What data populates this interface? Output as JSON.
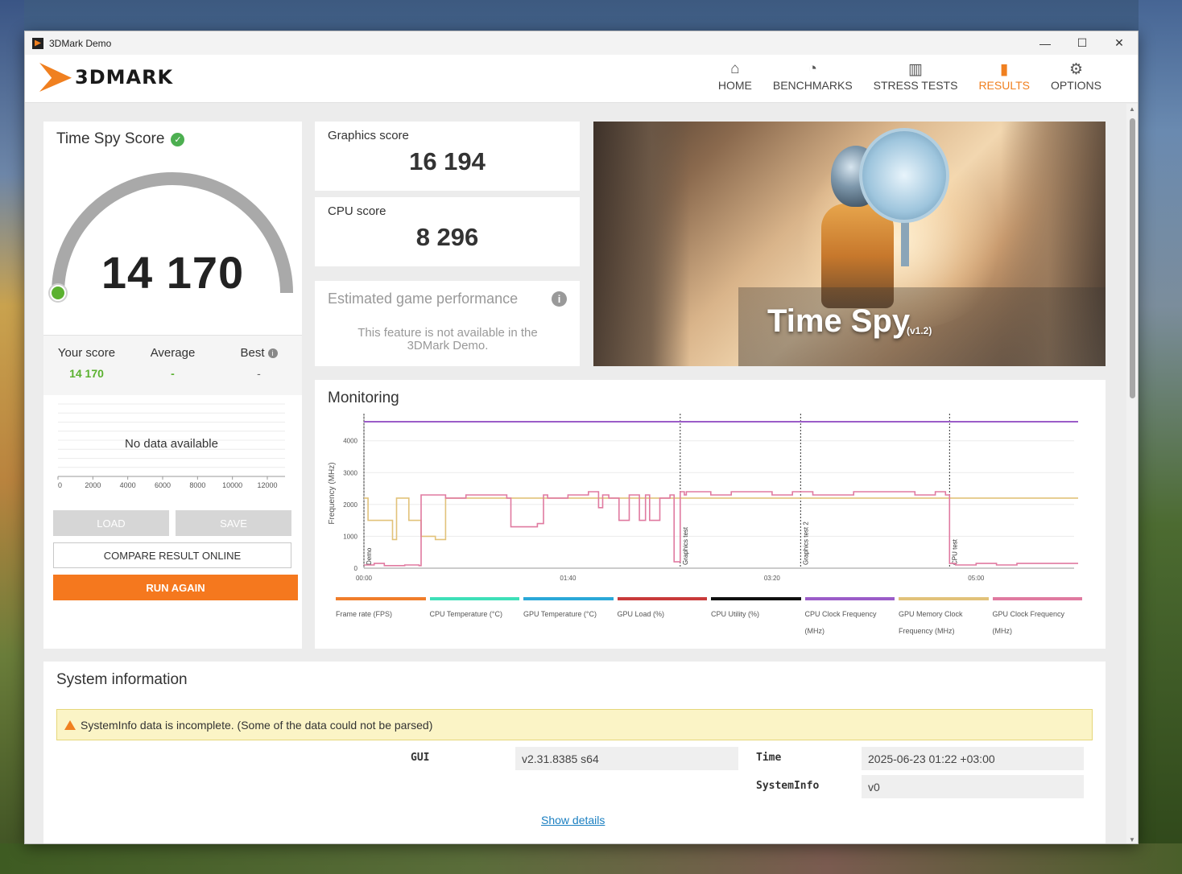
{
  "window": {
    "title": "3DMark Demo",
    "min_label": "—",
    "max_label": "☐",
    "close_label": "✕"
  },
  "logo": {
    "text": "3DMARK"
  },
  "nav": [
    {
      "label": "HOME",
      "icon": "home-icon",
      "glyph": "⌂"
    },
    {
      "label": "BENCHMARKS",
      "icon": "gauge-icon",
      "glyph": "◔"
    },
    {
      "label": "STRESS TESTS",
      "icon": "bar-chart-icon",
      "glyph": "▥"
    },
    {
      "label": "RESULTS",
      "icon": "results-icon",
      "glyph": "▮"
    },
    {
      "label": "OPTIONS",
      "icon": "gear-icon",
      "glyph": "⚙"
    }
  ],
  "active_nav": "RESULTS",
  "score": {
    "title": "Time Spy Score",
    "value": "14 170",
    "gauge_fraction": 0.0,
    "your_score_label": "Your score",
    "your_score_value": "14 170",
    "average_label": "Average",
    "average_value": "-",
    "best_label": "Best",
    "best_value": "-",
    "no_data": "No data available",
    "dist_ticks": [
      "0",
      "2000",
      "4000",
      "6000",
      "8000",
      "10000",
      "12000"
    ]
  },
  "buttons": {
    "load": "LOAD",
    "save": "SAVE",
    "compare": "COMPARE RESULT ONLINE",
    "run_again": "RUN AGAIN"
  },
  "graphics": {
    "label": "Graphics score",
    "value": "16 194"
  },
  "cpu": {
    "label": "CPU score",
    "value": "8 296"
  },
  "estimated": {
    "title": "Estimated game performance",
    "text": "This feature is not available in the 3DMark Demo."
  },
  "hero": {
    "title": "Time Spy",
    "version": "(v1.2)"
  },
  "monitoring": {
    "title": "Monitoring",
    "y_label": "Frequency (MHz)",
    "y_ticks": [
      "0",
      "1000",
      "2000",
      "3000",
      "4000"
    ],
    "x_ticks": [
      "00:00",
      "01:40",
      "03:20",
      "05:00"
    ],
    "markers": [
      "Demo",
      "Graphics test",
      "Graphics test 2",
      "CPU test"
    ],
    "legend": [
      {
        "label": "Frame rate (FPS)",
        "color": "#f07d2a"
      },
      {
        "label": "CPU Temperature (°C)",
        "color": "#3ee0b8"
      },
      {
        "label": "GPU Temperature (°C)",
        "color": "#2aa8d8"
      },
      {
        "label": "GPU Load (%)",
        "color": "#c83a3a"
      },
      {
        "label": "CPU Utility (%)",
        "color": "#111111"
      },
      {
        "label": "CPU Clock Frequency (MHz)",
        "color": "#9b5cc8"
      },
      {
        "label": "GPU Memory Clock Frequency (MHz)",
        "color": "#e2c27a"
      },
      {
        "label": "GPU Clock Frequency (MHz)",
        "color": "#e07aa0"
      }
    ]
  },
  "chart_data": {
    "type": "line",
    "xlabel": "",
    "ylabel": "Frequency (MHz)",
    "ylim": [
      0,
      4700
    ],
    "x_unit": "seconds",
    "xlim": [
      0,
      350
    ],
    "series": [
      {
        "name": "CPU Clock Frequency (MHz)",
        "color": "#9b5cc8",
        "x": [
          0,
          350
        ],
        "y": [
          4600,
          4600
        ]
      },
      {
        "name": "GPU Memory Clock Frequency (MHz)",
        "color": "#e2c27a",
        "x": [
          0,
          2,
          4,
          12,
          14,
          16,
          20,
          22,
          26,
          28,
          35,
          40,
          45,
          60,
          100,
          150,
          200,
          250,
          300,
          350
        ],
        "y": [
          2200,
          1500,
          1500,
          1500,
          900,
          2200,
          2200,
          1500,
          1500,
          1000,
          900,
          2200,
          2200,
          2200,
          2200,
          2200,
          2200,
          2200,
          2200,
          2200
        ]
      },
      {
        "name": "GPU Clock Frequency (MHz)",
        "color": "#e07aa0",
        "x": [
          0,
          5,
          10,
          20,
          27,
          28,
          30,
          40,
          50,
          60,
          70,
          72,
          75,
          85,
          88,
          90,
          100,
          110,
          115,
          117,
          120,
          125,
          130,
          135,
          138,
          140,
          145,
          150,
          152,
          155,
          157,
          158,
          160,
          170,
          180,
          190,
          200,
          210,
          220,
          240,
          260,
          270,
          280,
          285,
          287,
          290,
          300,
          310,
          320,
          330,
          340,
          350
        ],
        "y": [
          100,
          150,
          80,
          100,
          80,
          2300,
          2300,
          2200,
          2300,
          2300,
          2200,
          1300,
          1300,
          1400,
          2300,
          2200,
          2300,
          2400,
          1900,
          2300,
          2200,
          1500,
          2300,
          1500,
          2300,
          1500,
          2200,
          2300,
          200,
          2400,
          2300,
          2400,
          2400,
          2300,
          2400,
          2400,
          2300,
          2400,
          2300,
          2400,
          2400,
          2300,
          2400,
          2300,
          150,
          100,
          150,
          100,
          150,
          150,
          150,
          150
        ]
      }
    ],
    "markers": [
      {
        "label": "Demo",
        "x": 0
      },
      {
        "label": "Graphics test",
        "x": 155
      },
      {
        "label": "Graphics test 2",
        "x": 214
      },
      {
        "label": "CPU test",
        "x": 287
      }
    ],
    "grid": true
  },
  "system": {
    "title": "System information",
    "warning": "SystemInfo data is incomplete. (Some of the data could not be parsed)",
    "gui_key": "GUI",
    "gui_value": "v2.31.8385 s64",
    "time_key": "Time",
    "time_value": "2025-06-23 01:22 +03:00",
    "sysinfo_key": "SystemInfo",
    "sysinfo_value": "v0",
    "show_details": "Show details"
  }
}
